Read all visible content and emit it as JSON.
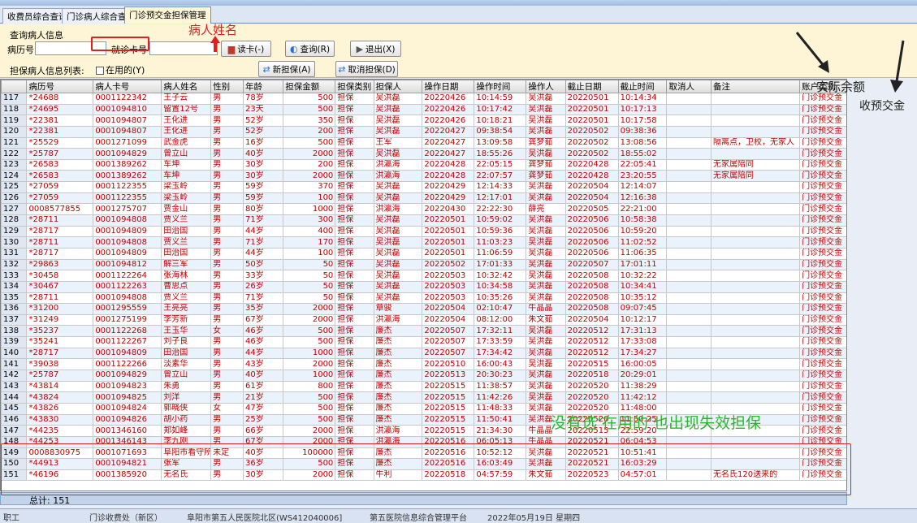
{
  "tabs": [
    "收费员综合查询",
    "门诊病人综合查询",
    "门诊预交金担保管理"
  ],
  "query": {
    "title": "查询病人信息",
    "record_label": "病历号",
    "card_label": "就诊卡号",
    "read_card": "读卡(-)",
    "search": "查询(R)",
    "exit": "退出(X)"
  },
  "list": {
    "label": "担保病人信息列表:",
    "in_use": "在用的(Y)",
    "add": "新担保(A)",
    "cancel": "取消担保(D)"
  },
  "columns": [
    "病历号",
    "病人卡号",
    "病人姓名",
    "性别",
    "年龄",
    "担保金额",
    "担保类别",
    "担保人",
    "操作日期",
    "操作时间",
    "操作人",
    "截止日期",
    "截止时间",
    "取消人",
    "备注",
    "账户类别"
  ],
  "rows": [
    [
      "117",
      "*24688",
      "0001122342",
      "王子云",
      "男",
      "78岁",
      "500",
      "担保",
      "吴洪磊",
      "20220426",
      "10:14:59",
      "吴洪磊",
      "20220501",
      "10:14:34",
      "",
      "",
      "门诊预交金"
    ],
    [
      "118",
      "*24695",
      "0001094810",
      "留置12号",
      "男",
      "23天",
      "500",
      "担保",
      "吴洪磊",
      "20220426",
      "10:17:42",
      "吴洪磊",
      "20220501",
      "10:17:13",
      "",
      "",
      "门诊预交金"
    ],
    [
      "119",
      "*22381",
      "0001094807",
      "王化进",
      "男",
      "52岁",
      "350",
      "担保",
      "吴洪磊",
      "20220426",
      "10:18:21",
      "吴洪磊",
      "20220501",
      "10:17:58",
      "",
      "",
      "门诊预交金"
    ],
    [
      "120",
      "*22381",
      "0001094807",
      "王化进",
      "男",
      "52岁",
      "200",
      "担保",
      "吴洪磊",
      "20220427",
      "09:38:54",
      "吴洪磊",
      "20220502",
      "09:38:36",
      "",
      "",
      "门诊预交金"
    ],
    [
      "121",
      "*25529",
      "0001271099",
      "武金虎",
      "男",
      "16岁",
      "500",
      "担保",
      "王军",
      "20220427",
      "13:09:58",
      "龚梦茹",
      "20220502",
      "13:08:56",
      "",
      "隔离点，卫校，无家人",
      "门诊预交金"
    ],
    [
      "122",
      "*25787",
      "0001094829",
      "曾立山",
      "男",
      "40岁",
      "2000",
      "担保",
      "吴洪磊",
      "20220427",
      "18:55:26",
      "吴洪磊",
      "20220502",
      "18:55:02",
      "",
      "",
      "门诊预交金"
    ],
    [
      "123",
      "*26583",
      "0001389262",
      "车坤",
      "男",
      "30岁",
      "200",
      "担保",
      "洪瀛海",
      "20220428",
      "22:05:15",
      "龚梦茹",
      "20220428",
      "22:05:41",
      "",
      "无家属陪同",
      "门诊预交金"
    ],
    [
      "124",
      "*26583",
      "0001389262",
      "车坤",
      "男",
      "30岁",
      "2000",
      "担保",
      "洪瀛海",
      "20220428",
      "22:07:57",
      "龚梦茹",
      "20220428",
      "23:20:55",
      "",
      "无家属陪同",
      "门诊预交金"
    ],
    [
      "125",
      "*27059",
      "0001122355",
      "梁玉岭",
      "男",
      "59岁",
      "370",
      "担保",
      "吴洪磊",
      "20220429",
      "12:14:33",
      "吴洪磊",
      "20220504",
      "12:14:07",
      "",
      "",
      "门诊预交金"
    ],
    [
      "126",
      "*27059",
      "0001122355",
      "梁玉岭",
      "男",
      "59岁",
      "100",
      "担保",
      "吴洪磊",
      "20220429",
      "12:17:01",
      "吴洪磊",
      "20220504",
      "12:16:38",
      "",
      "",
      "门诊预交金"
    ],
    [
      "127",
      "0008577855",
      "0001275707",
      "贾金山",
      "男",
      "80岁",
      "1000",
      "担保",
      "洪瀛海",
      "20220430",
      "22:22:30",
      "薛亮",
      "20220505",
      "22:21:00",
      "",
      "",
      "门诊预交金"
    ],
    [
      "128",
      "*28711",
      "0001094808",
      "贾义兰",
      "男",
      "71岁",
      "300",
      "担保",
      "吴洪磊",
      "20220501",
      "10:59:02",
      "吴洪磊",
      "20220506",
      "10:58:38",
      "",
      "",
      "门诊预交金"
    ],
    [
      "129",
      "*28717",
      "0001094809",
      "田治国",
      "男",
      "44岁",
      "400",
      "担保",
      "吴洪磊",
      "20220501",
      "10:59:36",
      "吴洪磊",
      "20220506",
      "10:59:20",
      "",
      "",
      "门诊预交金"
    ],
    [
      "130",
      "*28711",
      "0001094808",
      "贾义兰",
      "男",
      "71岁",
      "170",
      "担保",
      "吴洪磊",
      "20220501",
      "11:03:23",
      "吴洪磊",
      "20220506",
      "11:02:52",
      "",
      "",
      "门诊预交金"
    ],
    [
      "131",
      "*28717",
      "0001094809",
      "田治国",
      "男",
      "44岁",
      "100",
      "担保",
      "吴洪磊",
      "20220501",
      "11:06:59",
      "吴洪磊",
      "20220506",
      "11:06:35",
      "",
      "",
      "门诊预交金"
    ],
    [
      "132",
      "*29863",
      "0001094812",
      "解三军",
      "男",
      "50岁",
      "50",
      "担保",
      "吴洪磊",
      "20220502",
      "17:01:33",
      "吴洪磊",
      "20220507",
      "17:01:11",
      "",
      "",
      "门诊预交金"
    ],
    [
      "133",
      "*30458",
      "0001122264",
      "张海林",
      "男",
      "33岁",
      "50",
      "担保",
      "吴洪磊",
      "20220503",
      "10:32:42",
      "吴洪磊",
      "20220508",
      "10:32:22",
      "",
      "",
      "门诊预交金"
    ],
    [
      "134",
      "*30467",
      "0001122263",
      "曹思点",
      "男",
      "26岁",
      "50",
      "担保",
      "吴洪磊",
      "20220503",
      "10:34:58",
      "吴洪磊",
      "20220508",
      "10:34:41",
      "",
      "",
      "门诊预交金"
    ],
    [
      "135",
      "*28711",
      "0001094808",
      "贾义兰",
      "男",
      "71岁",
      "50",
      "担保",
      "吴洪磊",
      "20220503",
      "10:35:26",
      "吴洪磊",
      "20220508",
      "10:35:12",
      "",
      "",
      "门诊预交金"
    ],
    [
      "136",
      "*31200",
      "0001295559",
      "王亮亮",
      "男",
      "35岁",
      "2000",
      "担保",
      "章骏",
      "20220504",
      "02:10:47",
      "牛晶晶",
      "20220508",
      "09:07:45",
      "",
      "",
      "门诊预交金"
    ],
    [
      "137",
      "*31249",
      "0001275199",
      "李芳新",
      "男",
      "67岁",
      "2000",
      "担保",
      "洪瀛海",
      "20220504",
      "08:12:00",
      "朱文茹",
      "20220504",
      "10:12:17",
      "",
      "",
      "门诊预交金"
    ],
    [
      "138",
      "*35237",
      "0001122268",
      "王玉华",
      "女",
      "46岁",
      "500",
      "担保",
      "廉杰",
      "20220507",
      "17:32:11",
      "吴洪磊",
      "20220512",
      "17:31:13",
      "",
      "",
      "门诊预交金"
    ],
    [
      "139",
      "*35241",
      "0001122267",
      "刘子良",
      "男",
      "46岁",
      "500",
      "担保",
      "廉杰",
      "20220507",
      "17:33:59",
      "吴洪磊",
      "20220512",
      "17:33:08",
      "",
      "",
      "门诊预交金"
    ],
    [
      "140",
      "*28717",
      "0001094809",
      "田治国",
      "男",
      "44岁",
      "1000",
      "担保",
      "廉杰",
      "20220507",
      "17:34:42",
      "吴洪磊",
      "20220512",
      "17:34:27",
      "",
      "",
      "门诊预交金"
    ],
    [
      "141",
      "*39038",
      "0001122266",
      "淡素华",
      "男",
      "43岁",
      "2000",
      "担保",
      "廉杰",
      "20220510",
      "16:00:43",
      "吴洪磊",
      "20220515",
      "16:00:05",
      "",
      "",
      "门诊预交金"
    ],
    [
      "142",
      "*25787",
      "0001094829",
      "曾立山",
      "男",
      "40岁",
      "1000",
      "担保",
      "廉杰",
      "20220513",
      "20:30:23",
      "吴洪磊",
      "20220518",
      "20:29:01",
      "",
      "",
      "门诊预交金"
    ],
    [
      "143",
      "*43814",
      "0001094823",
      "朱勇",
      "男",
      "61岁",
      "800",
      "担保",
      "廉杰",
      "20220515",
      "11:38:57",
      "吴洪磊",
      "20220520",
      "11:38:29",
      "",
      "",
      "门诊预交金"
    ],
    [
      "144",
      "*43824",
      "0001094825",
      "刘洋",
      "男",
      "21岁",
      "500",
      "担保",
      "廉杰",
      "20220515",
      "11:42:26",
      "吴洪磊",
      "20220520",
      "11:42:12",
      "",
      "",
      "门诊预交金"
    ],
    [
      "145",
      "*43826",
      "0001094824",
      "郭晓侠",
      "女",
      "47岁",
      "500",
      "担保",
      "廉杰",
      "20220515",
      "11:48:33",
      "吴洪磊",
      "20220520",
      "11:48:00",
      "",
      "",
      "门诊预交金"
    ],
    [
      "146",
      "*43830",
      "0001094826",
      "胡小药",
      "男",
      "25岁",
      "500",
      "担保",
      "廉杰",
      "20220515",
      "11:50:41",
      "吴洪磊",
      "20220520",
      "11:50:25",
      "",
      "",
      "门诊预交金"
    ],
    [
      "147",
      "*44235",
      "0001346160",
      "郑如峰",
      "男",
      "66岁",
      "2000",
      "担保",
      "洪瀛海",
      "20220515",
      "21:34:30",
      "牛晶晶",
      "20220515",
      "22:59:20",
      "",
      "",
      "门诊预交金"
    ],
    [
      "148",
      "*44253",
      "0001346143",
      "李九刚",
      "男",
      "67岁",
      "2000",
      "担保",
      "洪瀛海",
      "20220516",
      "06:05:13",
      "牛晶晶",
      "20220521",
      "06:04:53",
      "",
      "",
      "门诊预交金"
    ],
    [
      "149",
      "0008830975",
      "0001071693",
      "阜阳市看守所",
      "未定",
      "40岁",
      "100000",
      "担保",
      "廉杰",
      "20220516",
      "10:52:12",
      "吴洪磊",
      "20220521",
      "10:51:41",
      "",
      "",
      "门诊预交金"
    ],
    [
      "150",
      "*44913",
      "0001094821",
      "张军",
      "男",
      "36岁",
      "500",
      "担保",
      "廉杰",
      "20220516",
      "16:03:49",
      "吴洪磊",
      "20220521",
      "16:03:29",
      "",
      "",
      "门诊预交金"
    ],
    [
      "151",
      "*46196",
      "0001385920",
      "无名氏",
      "男",
      "30岁",
      "2000",
      "担保",
      "牛利",
      "20220518",
      "04:57:59",
      "朱文茹",
      "20220523",
      "04:57:01",
      "",
      "无名氏120送来的",
      "门诊预交金"
    ]
  ],
  "total": "总计: 151",
  "status": [
    "职工",
    "门诊收费处（新区）",
    "阜阳市第五人民医院北区(WS412040006]",
    "第五医院信息综合管理平台",
    "2022年05月19日  星期四"
  ],
  "annotations": {
    "patient_name": "病人姓名",
    "actual_balance": "实际余额",
    "prepaid_received": "收预交金",
    "note": "没有选‘在用的‘也出现失效担保"
  },
  "colors": {
    "row_text": "#c00000",
    "annotation_red": "#e02020",
    "annotation_green": "#2db52d"
  }
}
